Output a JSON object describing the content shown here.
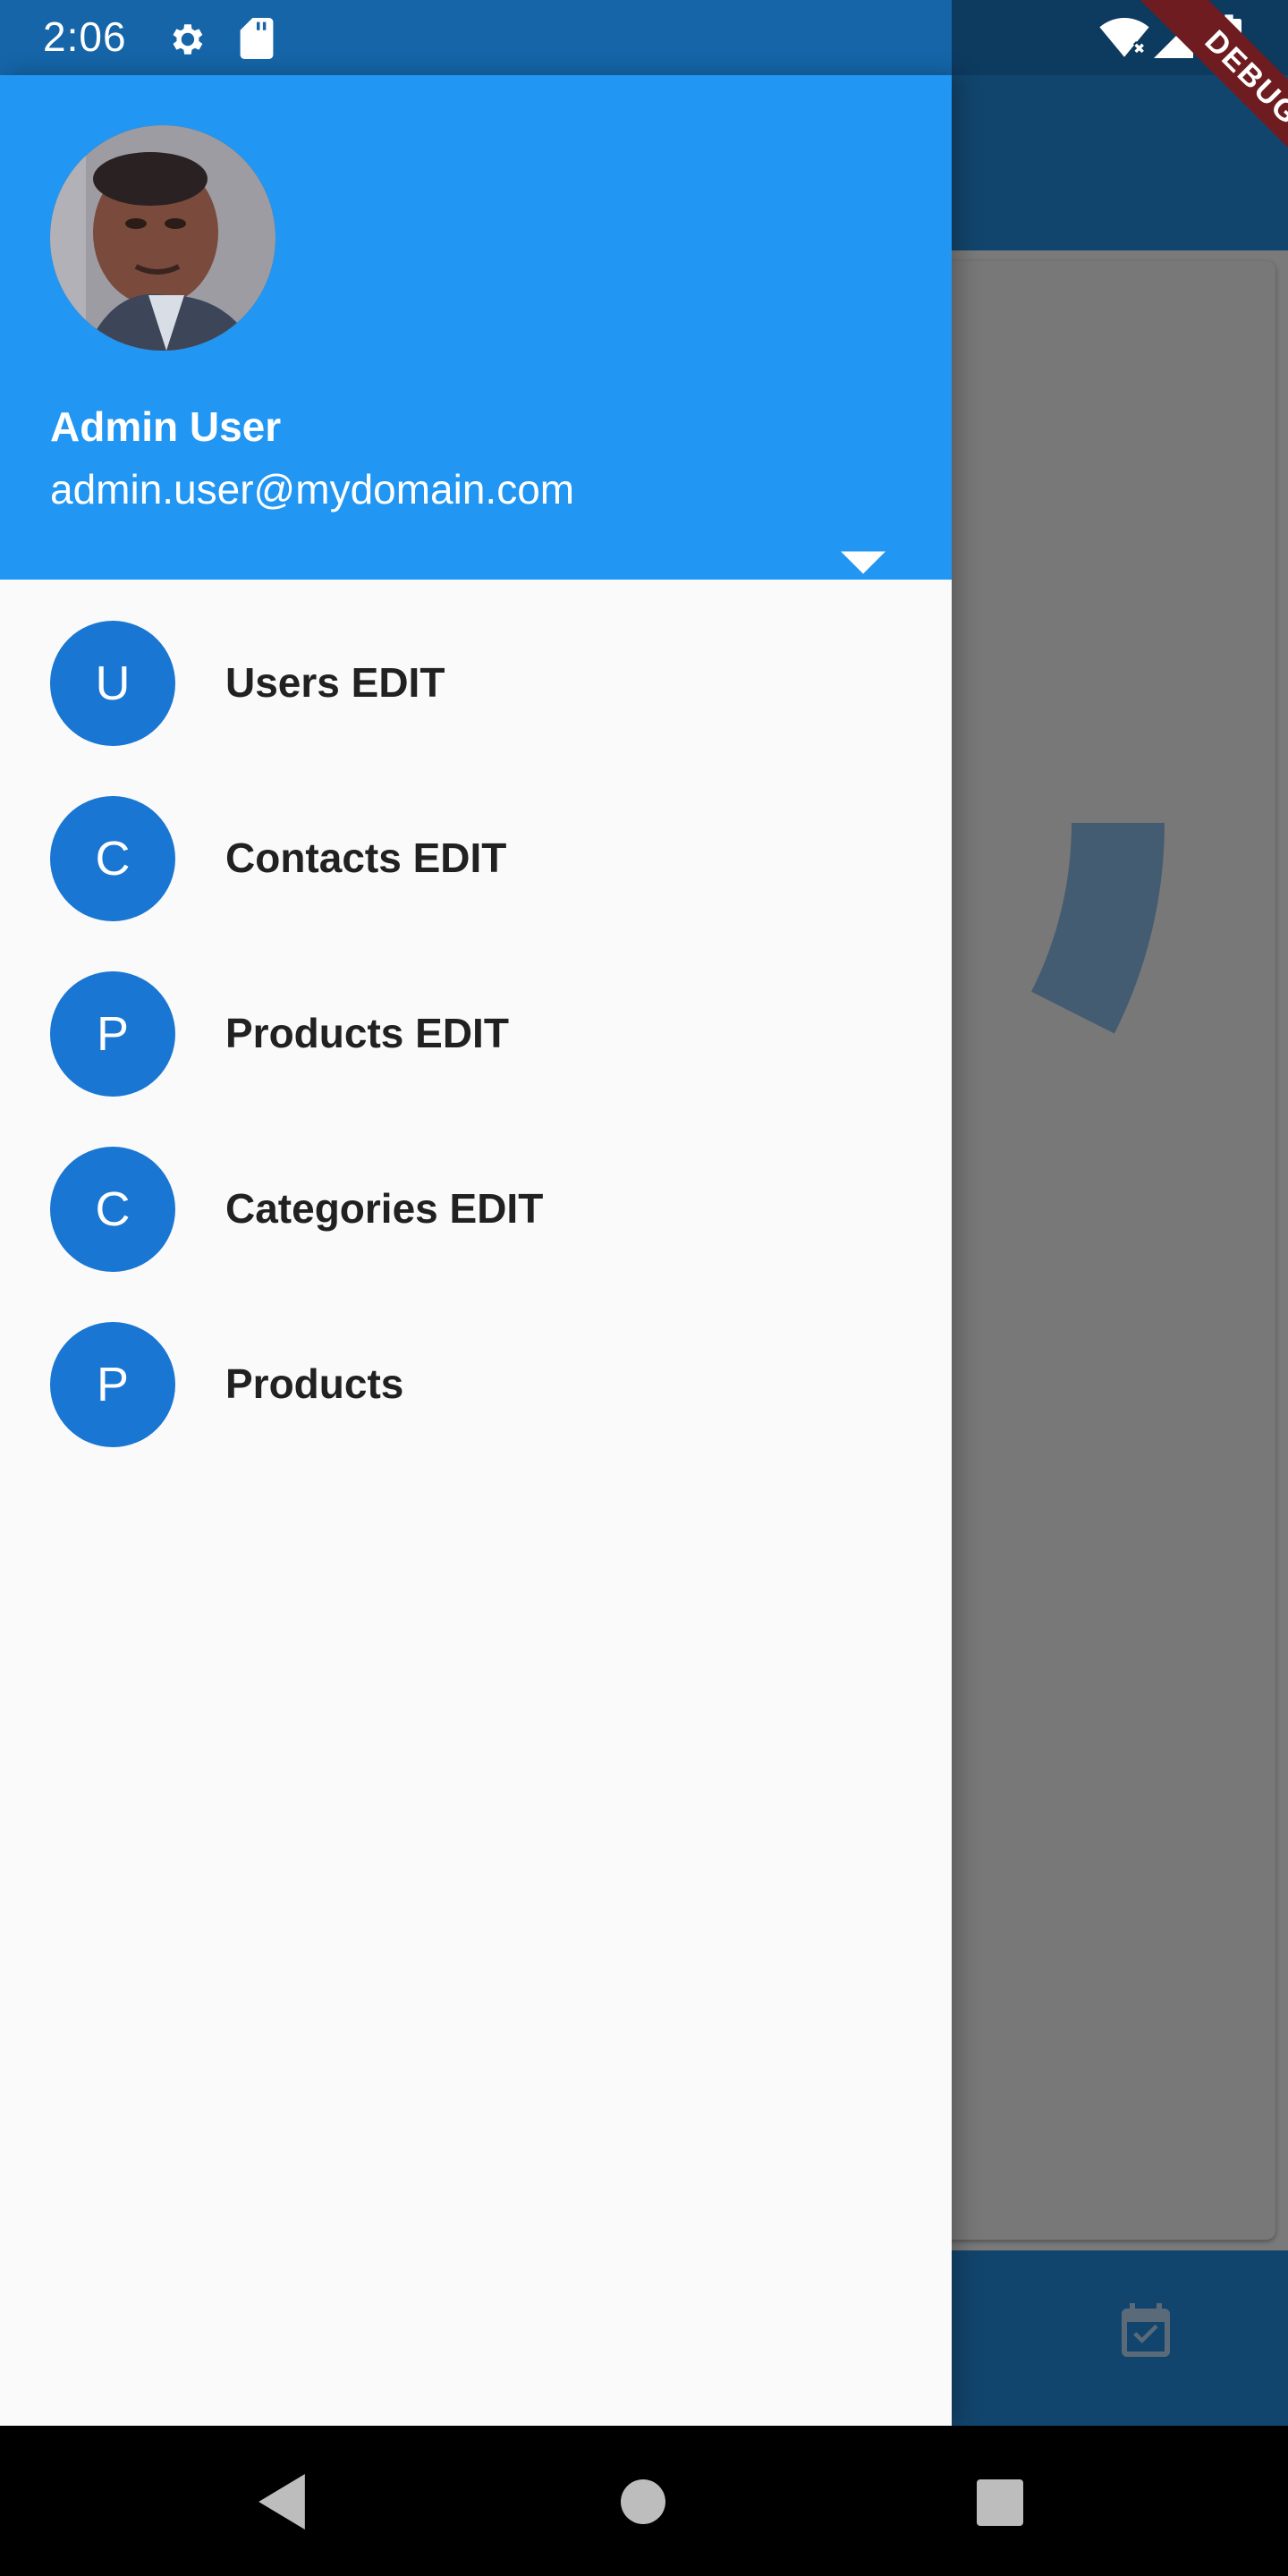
{
  "status_bar": {
    "time": "2:06",
    "left_icons": [
      "settings-icon",
      "sd-card-icon"
    ],
    "right_icons": [
      "wifi-icon",
      "signal-icon",
      "battery-icon"
    ],
    "debug_banner": "DEBUG"
  },
  "drawer": {
    "header": {
      "account_name": "Admin User",
      "account_email": "admin.user@mydomain.com",
      "avatar": "profile-photo",
      "dropdown_icon": "arrow-drop-down-icon"
    },
    "items": [
      {
        "initial": "U",
        "label": "Users EDIT"
      },
      {
        "initial": "C",
        "label": "Contacts EDIT"
      },
      {
        "initial": "P",
        "label": "Products EDIT"
      },
      {
        "initial": "C",
        "label": "Categories EDIT"
      },
      {
        "initial": "P",
        "label": "Products"
      }
    ]
  },
  "background_app": {
    "bottom_nav_icons": [
      "calendar-check-icon"
    ]
  },
  "nav_bar": {
    "icons": [
      "back-icon",
      "home-icon",
      "recents-icon"
    ]
  },
  "colors": {
    "drawer_header": "#2196f3",
    "item_avatar": "#1976d2",
    "status_bar": "#1565a8",
    "scrim_app_bar": "#12456d"
  }
}
